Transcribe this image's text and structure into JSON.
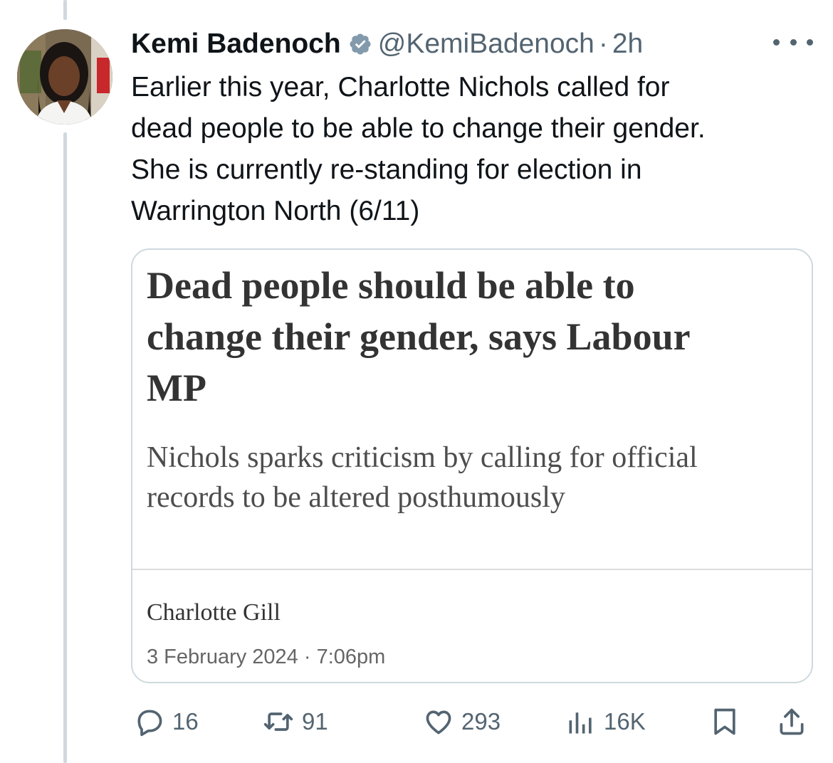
{
  "tweet": {
    "author_name": "Kemi Badenoch",
    "handle": "@KemiBadenoch",
    "separator": "·",
    "time": "2h",
    "text_lines": [
      "Earlier this year, Charlotte Nichols called for",
      "dead people to be able to change their gender.",
      "She is currently re-standing for election in",
      "Warrington North (6/11)"
    ]
  },
  "card": {
    "headline_lines": [
      "Dead people should be able to",
      "change their gender, says Labour",
      "MP"
    ],
    "standfirst_lines": [
      "Nichols sparks criticism by calling for official",
      "records to be altered posthumously"
    ],
    "author": "Charlotte Gill",
    "date": "3 February 2024 · 7:06pm"
  },
  "actions": {
    "replies": "16",
    "retweets": "91",
    "likes": "293",
    "views": "16K"
  },
  "icons": {
    "verified": "verified-badge-icon",
    "more": "more-options-icon",
    "reply": "reply-icon",
    "retweet": "retweet-icon",
    "like": "heart-icon",
    "views": "views-icon",
    "bookmark": "bookmark-icon",
    "share": "share-icon"
  },
  "colors": {
    "text": "#0f1419",
    "secondary": "#536471",
    "border": "#cfd9de",
    "verified_badge": "#829aab"
  }
}
